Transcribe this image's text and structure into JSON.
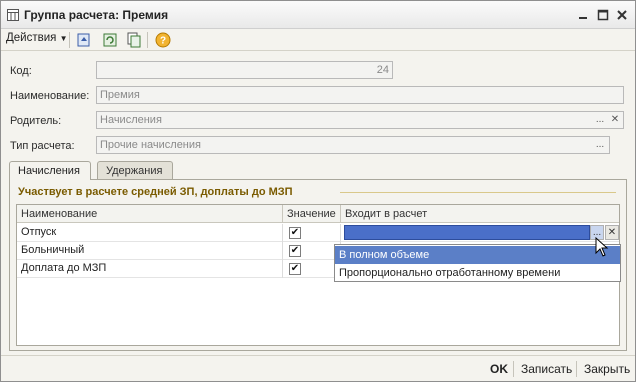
{
  "window": {
    "title": "Группа расчета: Премия"
  },
  "toolbar": {
    "actions_label": "Действия"
  },
  "form": {
    "code_label": "Код:",
    "code_value": "24",
    "name_label": "Наименование:",
    "name_value": "Премия",
    "parent_label": "Родитель:",
    "parent_value": "Начисления",
    "calc_type_label": "Тип расчета:",
    "calc_type_value": "Прочие начисления"
  },
  "tabs": [
    {
      "label": "Начисления",
      "active": true
    },
    {
      "label": "Удержания",
      "active": false
    }
  ],
  "section": {
    "title": "Участвует в расчете средней ЗП, доплаты до МЗП"
  },
  "table": {
    "headers": [
      "Наименование",
      "Значение",
      "Входит в расчет"
    ],
    "rows": [
      {
        "name": "Отпуск",
        "checked": true,
        "included": ""
      },
      {
        "name": "Больничный",
        "checked": true,
        "included": ""
      },
      {
        "name": "Доплата до МЗП",
        "checked": true,
        "included": ""
      }
    ]
  },
  "dropdown": {
    "options": [
      "В полном объеме",
      "Пропорционально отработанному времени"
    ],
    "highlighted": "В полном объеме"
  },
  "footer": {
    "ok_label": "OK",
    "save_label": "Записать",
    "close_label": "Закрыть"
  },
  "colors": {
    "accent": "#4a6fc9",
    "section_title": "#7a5b00"
  },
  "icons": [
    "form-icon",
    "minimize-icon",
    "maximize-icon",
    "close-icon",
    "move-up-icon",
    "refresh-icon",
    "copy-icon",
    "help-icon",
    "select-icon",
    "clear-icon"
  ]
}
